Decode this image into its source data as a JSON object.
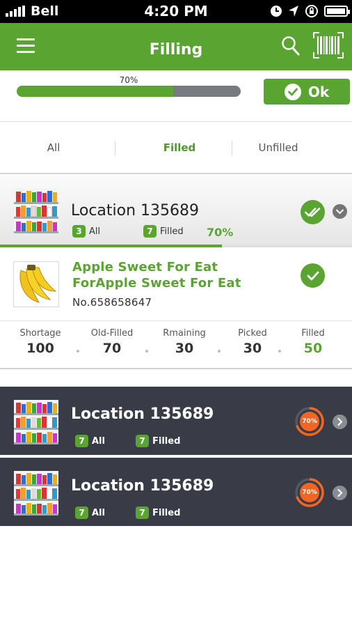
{
  "status_bar": {
    "carrier": "Bell",
    "time": "4:20 PM"
  },
  "header": {
    "title": "Filling"
  },
  "progress": {
    "percent_label": "70%",
    "fraction": 0.7
  },
  "ok_button": {
    "label": "Ok"
  },
  "tabs": [
    {
      "label": "All",
      "active": false
    },
    {
      "label": "Filled",
      "active": true
    },
    {
      "label": "Unfilled",
      "active": false
    }
  ],
  "expanded_location": {
    "title": "Location 135689",
    "all_count": "3",
    "all_label": "All",
    "filled_count": "7",
    "filled_label": "Filled",
    "percent": "70%",
    "progress_fraction": 0.63
  },
  "product": {
    "name_line1": "Apple Sweet For Eat",
    "name_line2": "ForApple Sweet For Eat",
    "number": "No.658658647"
  },
  "stats": [
    {
      "label": "Shortage",
      "value": "100"
    },
    {
      "label": "Old-Filled",
      "value": "70"
    },
    {
      "label": "Rmaining",
      "value": "30"
    },
    {
      "label": "Picked",
      "value": "30"
    },
    {
      "label": "Filled",
      "value": "50"
    }
  ],
  "locations": [
    {
      "title": "Location 135689",
      "all_count": "7",
      "all_label": "All",
      "filled_count": "7",
      "filled_label": "Filled",
      "percent": "70%",
      "fraction": 0.7
    },
    {
      "title": "Location 135689",
      "all_count": "7",
      "all_label": "All",
      "filled_count": "7",
      "filled_label": "Filled",
      "percent": "70%",
      "fraction": 0.7
    }
  ],
  "colors": {
    "accent": "#5aa532",
    "dark_card": "#393c46",
    "ring": "#f26522"
  }
}
